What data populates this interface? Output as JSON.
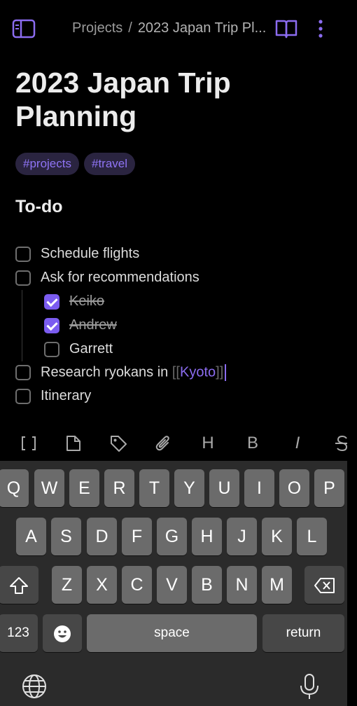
{
  "header": {
    "breadcrumb_parent": "Projects",
    "breadcrumb_sep": "/",
    "breadcrumb_current": "2023 Japan Trip Pl...",
    "sidebar_icon": "sidebar-icon",
    "reading_icon": "book-icon",
    "more_icon": "more-vertical-icon"
  },
  "note": {
    "title": "2023 Japan Trip Planning",
    "tags": [
      "#projects",
      "#travel"
    ],
    "heading": "To-do",
    "tasks": [
      {
        "label": "Schedule flights",
        "checked": false
      },
      {
        "label": "Ask for recommendations",
        "checked": false
      },
      {
        "label": "Keiko",
        "checked": true
      },
      {
        "label": "Andrew",
        "checked": true
      },
      {
        "label": "Garrett",
        "checked": false
      },
      {
        "label_prefix": "Research ryokans in ",
        "link_open": "[[",
        "link": "Kyoto",
        "link_close": "]]",
        "checked": false
      },
      {
        "label": "Itinerary",
        "checked": false
      }
    ]
  },
  "toolbar": {
    "items": [
      "wikilink-icon",
      "file-icon",
      "tag-icon",
      "attachment-icon",
      "heading-icon",
      "bold-icon",
      "italic-icon",
      "strikethrough-icon"
    ],
    "heading_glyph": "H",
    "bold_glyph": "B",
    "italic_glyph": "I",
    "wikilink_glyph": "[]"
  },
  "keyboard": {
    "row1": [
      "Q",
      "W",
      "E",
      "R",
      "T",
      "Y",
      "U",
      "I",
      "O",
      "P"
    ],
    "row2": [
      "A",
      "S",
      "D",
      "F",
      "G",
      "H",
      "J",
      "K",
      "L"
    ],
    "row3": [
      "Z",
      "X",
      "C",
      "V",
      "B",
      "N",
      "M"
    ],
    "numbers_key": "123",
    "space_key": "space",
    "return_key": "return",
    "shift_icon": "shift-icon",
    "delete_icon": "backspace-icon",
    "emoji_icon": "emoji-icon",
    "globe_icon": "globe-icon",
    "mic_icon": "microphone-icon"
  },
  "colors": {
    "accent": "#8b6cf0",
    "background": "#000000",
    "keyboard_bg": "#2b2b2b",
    "key": "#6b6b6b"
  }
}
